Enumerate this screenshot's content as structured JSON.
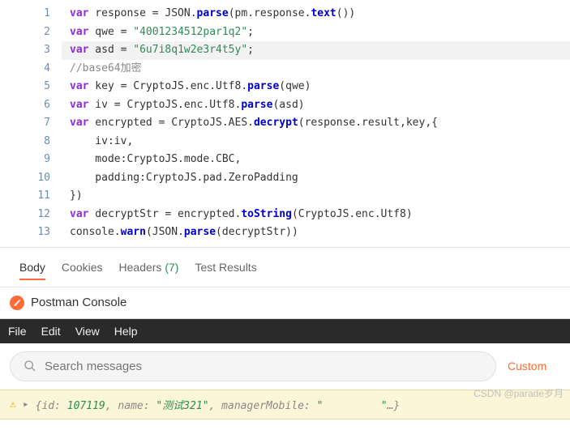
{
  "code": {
    "lines": [
      {
        "n": 1,
        "hl": false,
        "html": "<span class='kw'>var</span> response = JSON.<span class='fn'>parse</span>(pm.response.<span class='fn'>text</span>())"
      },
      {
        "n": 2,
        "hl": false,
        "html": "<span class='kw'>var</span> qwe = <span class='str'>\"4001234512par1q2\"</span>;"
      },
      {
        "n": 3,
        "hl": true,
        "html": "<span class='kw'>var</span> asd = <span class='str'>\"6u7i8q1w2e3r4t5y\"</span>;"
      },
      {
        "n": 4,
        "hl": false,
        "html": "<span class='cmt'>//base64加密</span>"
      },
      {
        "n": 5,
        "hl": false,
        "html": "<span class='kw'>var</span> key = CryptoJS.enc.Utf8.<span class='fn'>parse</span>(qwe)"
      },
      {
        "n": 6,
        "hl": false,
        "html": "<span class='kw'>var</span> iv = CryptoJS.enc.Utf8.<span class='fn'>parse</span>(asd)"
      },
      {
        "n": 7,
        "hl": false,
        "html": "<span class='kw'>var</span> encrypted = CryptoJS.AES.<span class='fn'>decrypt</span>(response.result,key,{"
      },
      {
        "n": 8,
        "hl": false,
        "html": "    iv:iv,"
      },
      {
        "n": 9,
        "hl": false,
        "html": "    mode:CryptoJS.mode.CBC,"
      },
      {
        "n": 10,
        "hl": false,
        "html": "    padding:CryptoJS.pad.ZeroPadding"
      },
      {
        "n": 11,
        "hl": false,
        "html": "})"
      },
      {
        "n": 12,
        "hl": false,
        "html": "<span class='kw'>var</span> decryptStr = encrypted.<span class='fn'>toString</span>(CryptoJS.enc.Utf8)"
      },
      {
        "n": 13,
        "hl": false,
        "html": "console.<span class='fn'>warn</span>(JSON.<span class='fn'>parse</span>(decryptStr))"
      }
    ]
  },
  "tabs": {
    "body": "Body",
    "cookies": "Cookies",
    "headers": "Headers",
    "headers_count": "(7)",
    "test_results": "Test Results"
  },
  "console": {
    "title": "Postman Console",
    "menu": {
      "file": "File",
      "edit": "Edit",
      "view": "View",
      "help": "Help"
    },
    "search_placeholder": "Search messages",
    "custom": "Custom"
  },
  "log": {
    "prefix": "{id: ",
    "id": "107119",
    "sep1": ", name: ",
    "name": "\"测试321\"",
    "sep2": ", managerMobile: ",
    "mobile_open": "\"",
    "mobile_close": "\"",
    "suffix": "…}"
  },
  "watermark": "CSDN @parade岁月"
}
